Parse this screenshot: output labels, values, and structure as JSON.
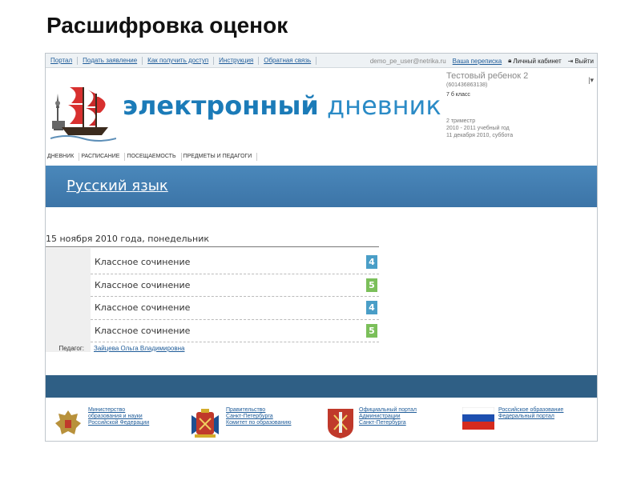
{
  "slide": {
    "title": "Расшифровка оценок"
  },
  "topbar": {
    "links": [
      "Портал",
      "Подать заявление",
      "Как получить доступ",
      "Инструкция",
      "Обратная связь"
    ],
    "email": "demo_pe_user@netrika.ru",
    "mail_link": "Ваша переписка",
    "cabinet": "Личный кабинет",
    "logout": "Выйти"
  },
  "brand": {
    "bold": "электронный",
    "light": "дневник"
  },
  "student": {
    "name": "Тестовый ребенок 2",
    "id": "(601436863138)",
    "class": "7 б класс",
    "term": "2 триместр",
    "year": "2010 - 2011 учебный год",
    "date": "11 декабря 2010, суббота"
  },
  "nav": [
    "ДНЕВНИК",
    "РАСПИСАНИЕ",
    "ПОСЕЩАЕМОСТЬ",
    "ПРЕДМЕТЫ И ПЕДАГОГИ"
  ],
  "subject": "Русский язык",
  "lesson": {
    "date": "15 ноября 2010 года, понедельник",
    "grades": [
      {
        "work": "Классное сочинение",
        "mark": "4",
        "color": "#4a9ec7"
      },
      {
        "work": "Классное сочинение",
        "mark": "5",
        "color": "#7bbf5a"
      },
      {
        "work": "Классное сочинение",
        "mark": "4",
        "color": "#4a9ec7"
      },
      {
        "work": "Классное сочинение",
        "mark": "5",
        "color": "#7bbf5a"
      }
    ],
    "teacher_label": "Педагог:",
    "teacher": "Зайцева Ольга Владимировна"
  },
  "footer": [
    {
      "lines": [
        "Министерство",
        "образования и науки",
        "Российской Федерации"
      ],
      "icon": "russia-coat-of-arms-icon"
    },
    {
      "lines": [
        "Правительство",
        "Санкт-Петербурга",
        "Комитет по образованию"
      ],
      "icon": "spb-coat-of-arms-icon"
    },
    {
      "lines": [
        "Официальный портал",
        "Администрации",
        "Санкт-Петербурга"
      ],
      "icon": "spb-admin-emblem-icon"
    },
    {
      "lines": [
        "Российское образование",
        "Федеральный портал"
      ],
      "icon": "russian-flag-icon"
    }
  ]
}
